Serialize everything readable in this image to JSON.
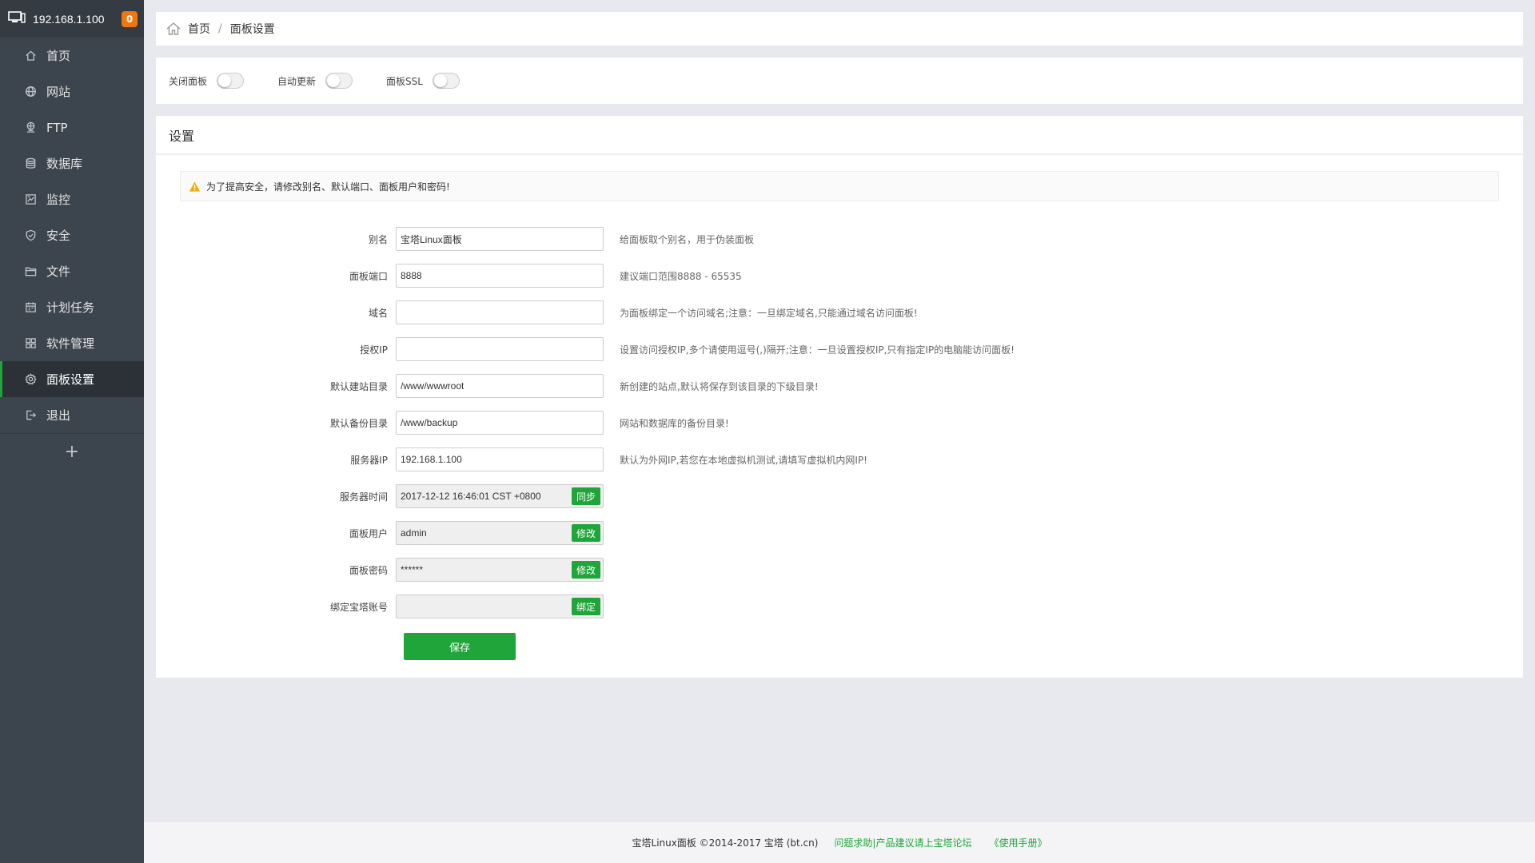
{
  "sidebar": {
    "host": "192.168.1.100",
    "badge": "0",
    "items": [
      {
        "label": "首页",
        "icon": "home-icon"
      },
      {
        "label": "网站",
        "icon": "globe-icon"
      },
      {
        "label": "FTP",
        "icon": "ftp-icon"
      },
      {
        "label": "数据库",
        "icon": "database-icon"
      },
      {
        "label": "监控",
        "icon": "monitor-icon"
      },
      {
        "label": "安全",
        "icon": "shield-icon"
      },
      {
        "label": "文件",
        "icon": "folder-icon"
      },
      {
        "label": "计划任务",
        "icon": "calendar-icon"
      },
      {
        "label": "软件管理",
        "icon": "grid-icon"
      },
      {
        "label": "面板设置",
        "icon": "gear-icon"
      },
      {
        "label": "退出",
        "icon": "logout-icon"
      }
    ],
    "active_index": 9,
    "add_label": "+"
  },
  "breadcrumb": {
    "home": "首页",
    "separator": "/",
    "current": "面板设置"
  },
  "toggles": [
    {
      "label": "关闭面板",
      "on": false
    },
    {
      "label": "自动更新",
      "on": false
    },
    {
      "label": "面板SSL",
      "on": false
    }
  ],
  "settings": {
    "title": "设置",
    "warning": "为了提高安全，请修改别名、默认端口、面板用户和密码!",
    "fields": {
      "alias": {
        "label": "别名",
        "value": "宝塔Linux面板",
        "hint": "给面板取个别名，用于伪装面板"
      },
      "port": {
        "label": "面板端口",
        "value": "8888",
        "hint": "建议端口范围8888 - 65535"
      },
      "domain": {
        "label": "域名",
        "value": "",
        "hint": "为面板绑定一个访问域名;注意：一旦绑定域名,只能通过域名访问面板!"
      },
      "auth_ip": {
        "label": "授权IP",
        "value": "",
        "hint": "设置访问授权IP,多个请使用逗号(,)隔开;注意：一旦设置授权IP,只有指定IP的电脑能访问面板!"
      },
      "site_dir": {
        "label": "默认建站目录",
        "value": "/www/wwwroot",
        "hint": "新创建的站点,默认将保存到该目录的下级目录!"
      },
      "backup_dir": {
        "label": "默认备份目录",
        "value": "/www/backup",
        "hint": "网站和数据库的备份目录!"
      },
      "server_ip": {
        "label": "服务器IP",
        "value": "192.168.1.100",
        "hint": "默认为外网IP,若您在本地虚拟机测试,请填写虚拟机内网IP!"
      },
      "server_time": {
        "label": "服务器时间",
        "value": "2017-12-12 16:46:01 CST +0800",
        "button": "同步"
      },
      "panel_user": {
        "label": "面板用户",
        "value": "admin",
        "button": "修改"
      },
      "panel_password": {
        "label": "面板密码",
        "value": "******",
        "button": "修改"
      },
      "bt_account": {
        "label": "绑定宝塔账号",
        "value": "",
        "button": "绑定"
      }
    },
    "save_label": "保存"
  },
  "footer": {
    "copyright": "宝塔Linux面板 ©2014-2017 宝塔 (bt.cn)",
    "forum_link": "问题求助|产品建议请上宝塔论坛",
    "manual_link": "《使用手册》"
  },
  "colors": {
    "accent": "#20a53a",
    "sidebar_bg": "#3c444d",
    "badge": "#f0770e",
    "warning": "#f0ad00"
  }
}
